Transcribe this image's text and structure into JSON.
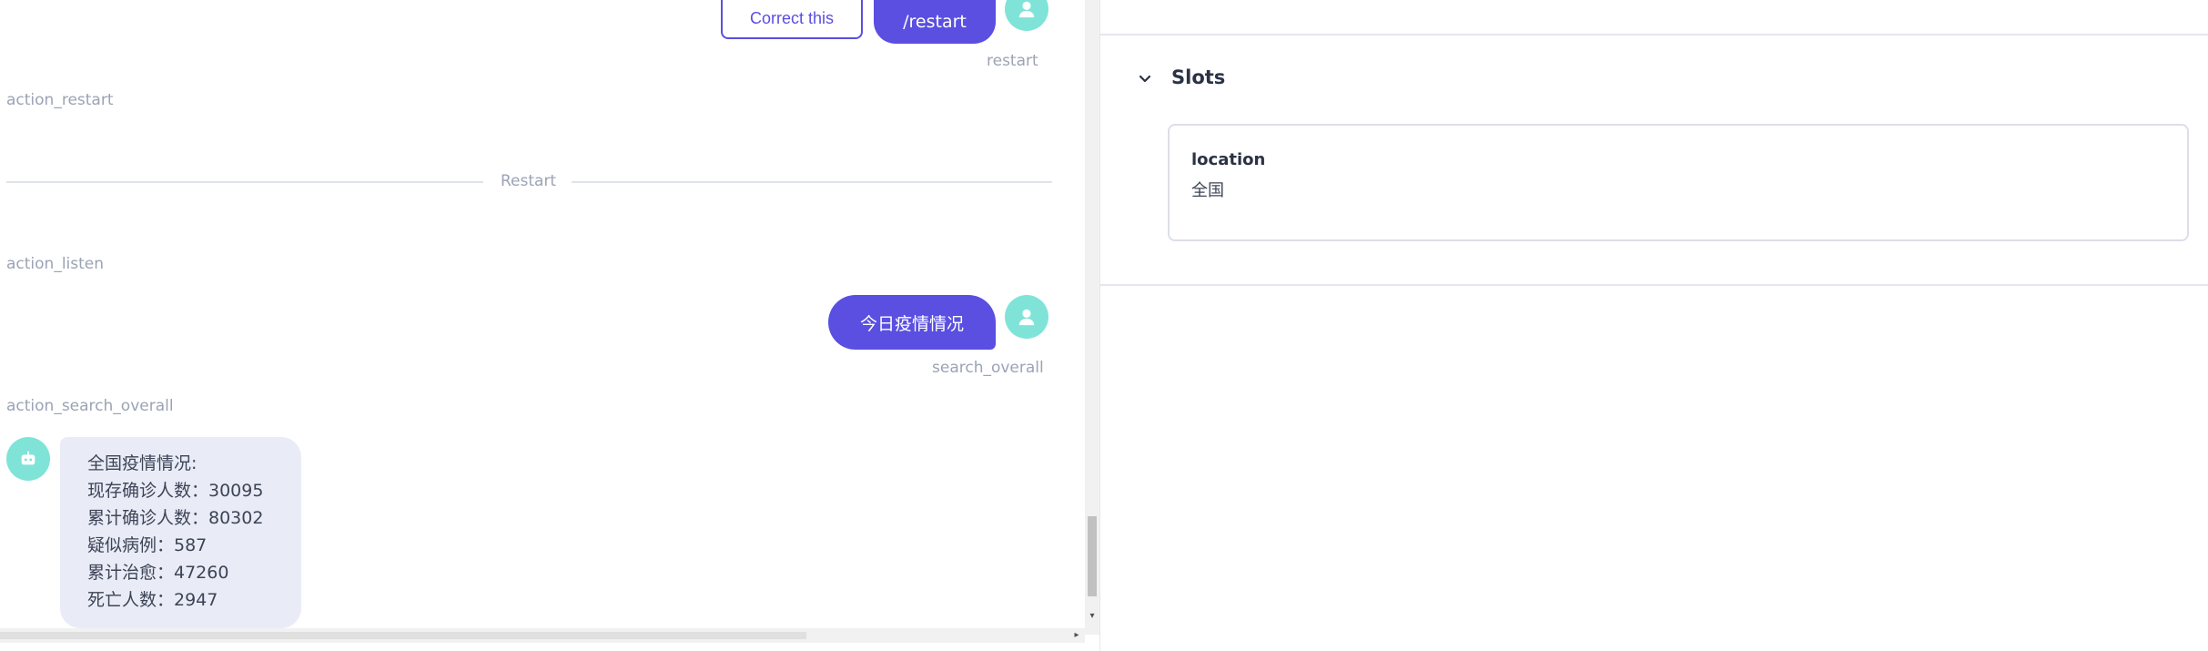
{
  "chat": {
    "correct_button": "Correct this",
    "restart_message": "/restart",
    "restart_intent": "restart",
    "action_restart": "action_restart",
    "divider_label": "Restart",
    "action_listen": "action_listen",
    "user_message": "今日疫情情况",
    "user_intent": "search_overall",
    "action_search": "action_search_overall",
    "bot_lines": [
      "全国疫情情况:",
      "现存确诊人数：30095",
      "累计确诊人数：80302",
      "疑似病例：587",
      "累计治愈：47260",
      "死亡人数：2947"
    ]
  },
  "slots": {
    "title": "Slots",
    "items": [
      {
        "name": "location",
        "value": "全国"
      }
    ]
  },
  "colors": {
    "accent": "#5a4fe0",
    "avatar": "#7fe3d8",
    "bot_bubble": "#e9ecf6",
    "muted_text": "#9ba3b5"
  },
  "icons": {
    "user_avatar": "user-icon",
    "bot_avatar": "robot-icon",
    "section_toggle": "chevron-down-icon"
  }
}
